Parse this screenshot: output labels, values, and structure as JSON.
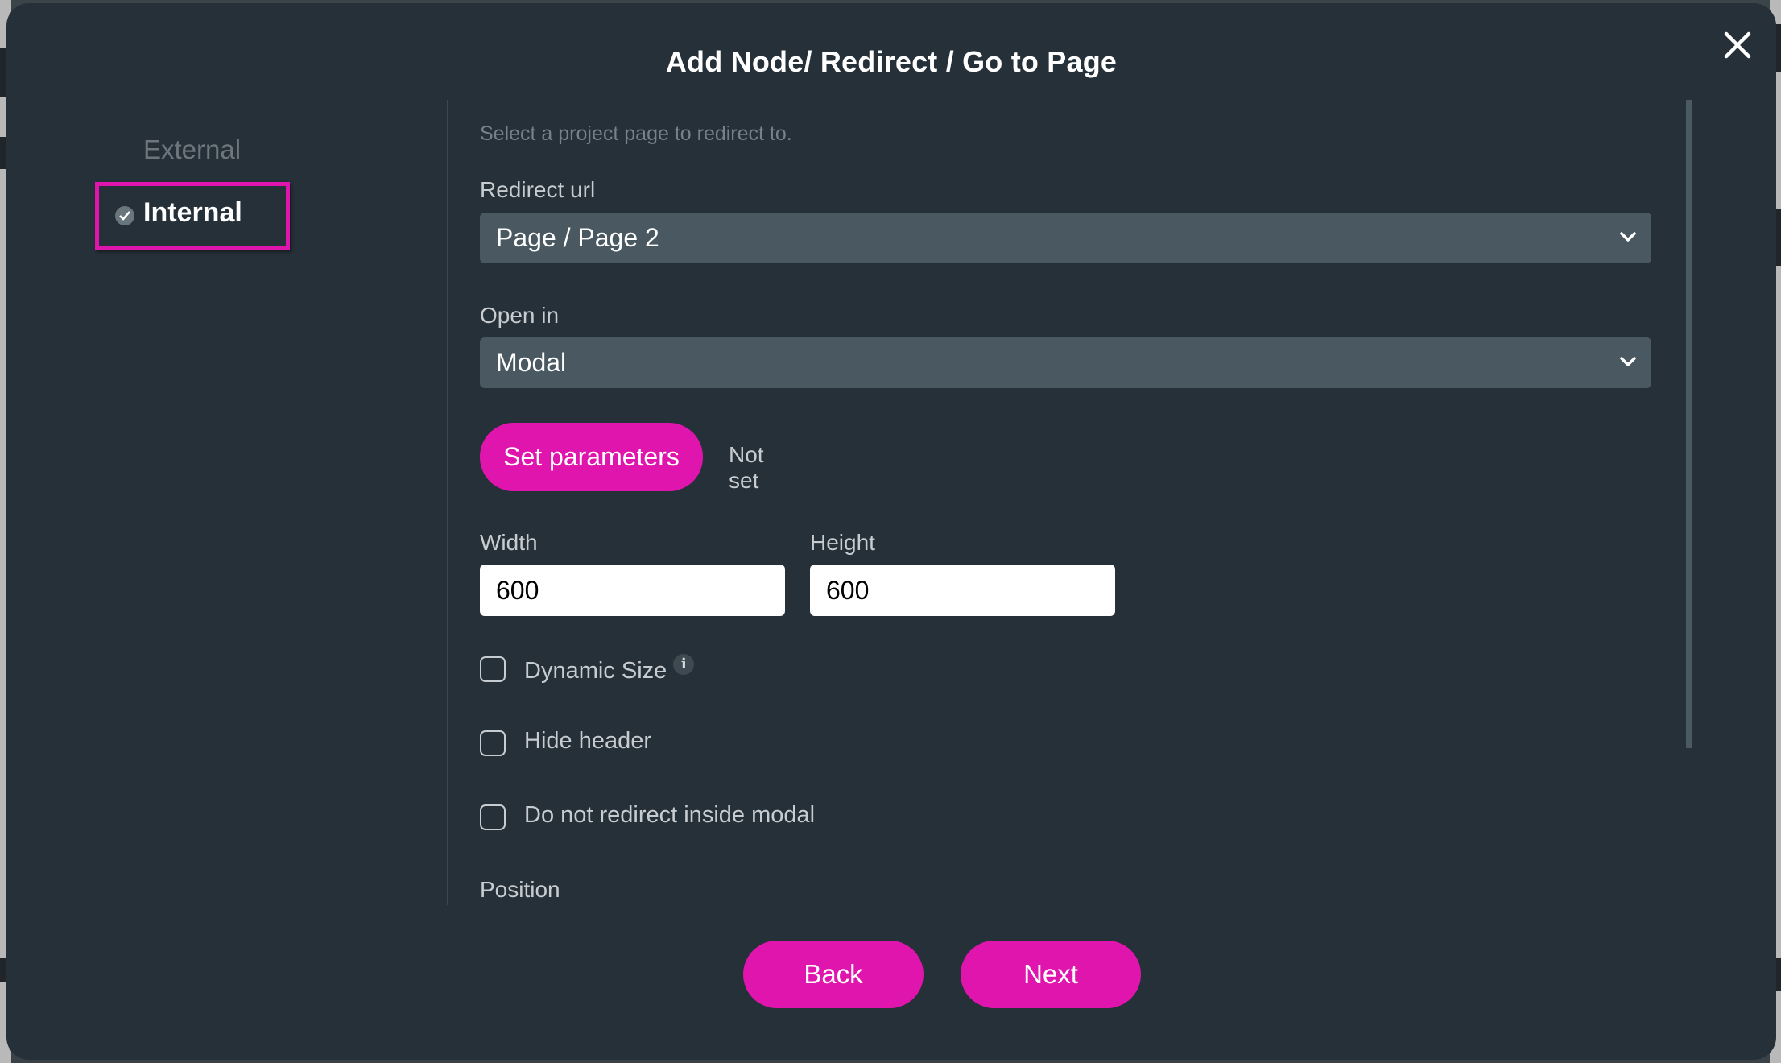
{
  "dialog": {
    "title": "Add Node/ Redirect / Go to Page",
    "close_icon": "close-icon"
  },
  "tabs": {
    "external": "External",
    "internal": "Internal",
    "selected": "Internal",
    "highlight_color": "#e015ad"
  },
  "form": {
    "hint": "Select a project page to redirect to.",
    "redirect_url": {
      "label": "Redirect url",
      "value": "Page / Page 2"
    },
    "open_in": {
      "label": "Open in",
      "value": "Modal"
    },
    "parameters": {
      "button_label": "Set parameters",
      "status": "Not set"
    },
    "width": {
      "label": "Width",
      "value": "600"
    },
    "height": {
      "label": "Height",
      "value": "600"
    },
    "checkboxes": [
      {
        "label": "Dynamic Size",
        "checked": false,
        "info": "i"
      },
      {
        "label": "Hide header",
        "checked": false
      },
      {
        "label": "Do not redirect inside modal",
        "checked": false
      }
    ],
    "position_label": "Position"
  },
  "footer": {
    "back_label": "Back",
    "next_label": "Next"
  },
  "colors": {
    "accent": "#e015ad",
    "modal_bg": "#263038",
    "select_bg": "#4a5861"
  }
}
